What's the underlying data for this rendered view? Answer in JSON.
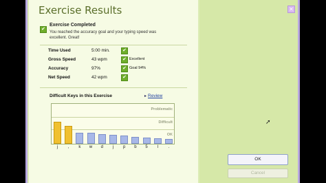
{
  "window": {
    "title": "Exercise Results"
  },
  "completed": {
    "heading": "Exercise Completed",
    "message": "You reached the accuracy goal and your typing speed was excellent. Great!"
  },
  "stats": [
    {
      "label": "Time Used",
      "value": "5:00 min.",
      "note": ""
    },
    {
      "label": "Gross Speed",
      "value": "43 wpm",
      "note": "Excellent"
    },
    {
      "label": "Accuracy",
      "value": "97%",
      "note": "Goal 94%"
    },
    {
      "label": "Net Speed",
      "value": "42 wpm",
      "note": ""
    }
  ],
  "difficult_keys": {
    "title": "Difficult Keys in this Exercise",
    "review_label": "Review",
    "zones": [
      "Problematic",
      "Difficult",
      "OK"
    ],
    "colors": {
      "problematic": "#f0c030",
      "ok": "#a8b8e8"
    },
    "keys": [
      {
        "key": "j",
        "level": 0.56,
        "zone": "problematic"
      },
      {
        "key": ",",
        "level": 0.44,
        "zone": "problematic"
      },
      {
        "key": "k",
        "level": 0.27,
        "zone": "ok"
      },
      {
        "key": "w",
        "level": 0.27,
        "zone": "ok"
      },
      {
        "key": "d",
        "level": 0.24,
        "zone": "ok"
      },
      {
        "key": "j",
        "level": 0.22,
        "zone": "ok"
      },
      {
        "key": "p",
        "level": 0.2,
        "zone": "ok"
      },
      {
        "key": "b",
        "level": 0.18,
        "zone": "ok"
      },
      {
        "key": "5",
        "level": 0.16,
        "zone": "ok"
      },
      {
        "key": "l",
        "level": 0.14,
        "zone": "ok"
      },
      {
        "key": ".",
        "level": 0.12,
        "zone": "ok"
      }
    ]
  },
  "buttons": {
    "ok": "OK",
    "cancel": "Cancel"
  }
}
